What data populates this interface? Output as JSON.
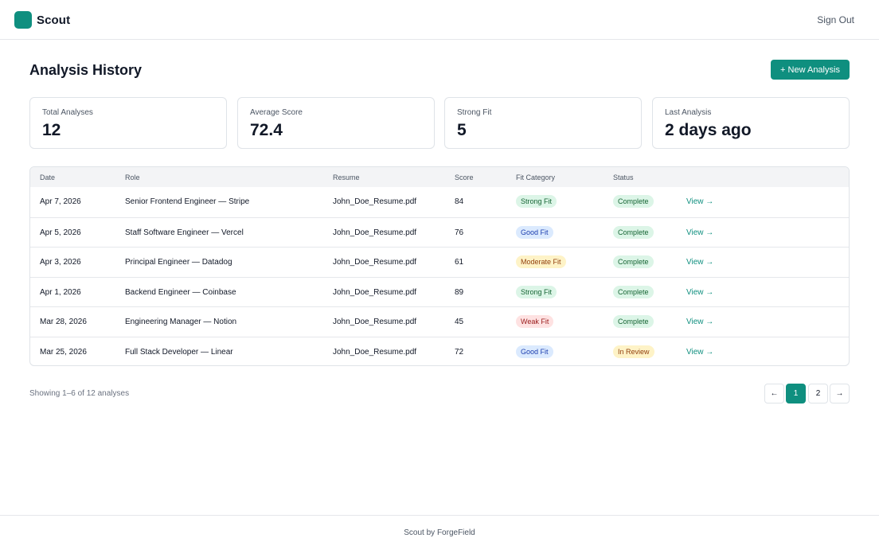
{
  "app": {
    "name": "Scout",
    "sign_out_label": "Sign Out"
  },
  "page": {
    "title": "Analysis History",
    "new_button_label": "+ New Analysis"
  },
  "stats": [
    {
      "label": "Total Analyses",
      "value": "12"
    },
    {
      "label": "Average Score",
      "value": "72.4"
    },
    {
      "label": "Strong Fit",
      "value": "5"
    },
    {
      "label": "Last Analysis",
      "value": "2 days ago"
    }
  ],
  "table": {
    "columns": [
      "Date",
      "Role",
      "Resume",
      "Score",
      "Fit Category",
      "Status"
    ],
    "view_label": "View →",
    "rows": [
      {
        "date": "Apr 7, 2026",
        "role": "Senior Frontend Engineer — Stripe",
        "resume": "John_Doe_Resume.pdf",
        "score": "84",
        "fit": "Strong Fit",
        "status": "Complete"
      },
      {
        "date": "Apr 5, 2026",
        "role": "Staff Software Engineer — Vercel",
        "resume": "John_Doe_Resume.pdf",
        "score": "76",
        "fit": "Good Fit",
        "status": "Complete"
      },
      {
        "date": "Apr 3, 2026",
        "role": "Principal Engineer — Datadog",
        "resume": "John_Doe_Resume.pdf",
        "score": "61",
        "fit": "Moderate Fit",
        "status": "Complete"
      },
      {
        "date": "Apr 1, 2026",
        "role": "Backend Engineer — Coinbase",
        "resume": "John_Doe_Resume.pdf",
        "score": "89",
        "fit": "Strong Fit",
        "status": "Complete"
      },
      {
        "date": "Mar 28, 2026",
        "role": "Engineering Manager — Notion",
        "resume": "John_Doe_Resume.pdf",
        "score": "45",
        "fit": "Weak Fit",
        "status": "Complete"
      },
      {
        "date": "Mar 25, 2026",
        "role": "Full Stack Developer — Linear",
        "resume": "John_Doe_Resume.pdf",
        "score": "72",
        "fit": "Good Fit",
        "status": "In Review"
      }
    ]
  },
  "pill_colors": {
    "Strong Fit": {
      "bg": "#dcf5e7",
      "fg": "#166534"
    },
    "Good Fit": {
      "bg": "#dbeafe",
      "fg": "#1e40af"
    },
    "Moderate Fit": {
      "bg": "#fef3c7",
      "fg": "#92400e"
    },
    "Weak Fit": {
      "bg": "#fee2e2",
      "fg": "#991b1b"
    },
    "Complete": {
      "bg": "#dcf5e7",
      "fg": "#166534"
    },
    "In Review": {
      "bg": "#fef3c7",
      "fg": "#92400e"
    }
  },
  "pagination": {
    "showing_text": "Showing 1–6 of 12 analyses",
    "prev_label": "←",
    "pages": [
      "1",
      "2"
    ],
    "active_page": "1",
    "next_label": "→"
  },
  "footer": {
    "text": "Scout by ForgeField"
  },
  "colors": {
    "accent": "#0f8f7f"
  }
}
